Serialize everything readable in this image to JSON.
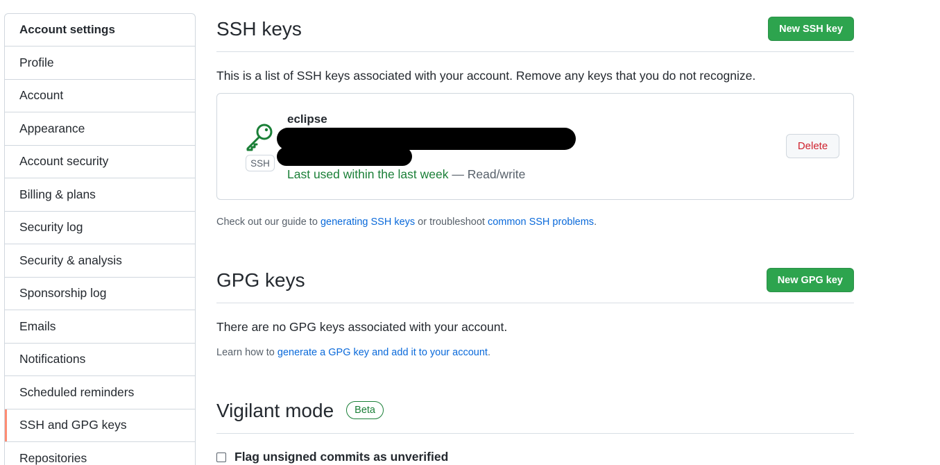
{
  "sidebar": {
    "header": "Account settings",
    "items": [
      {
        "label": "Profile"
      },
      {
        "label": "Account"
      },
      {
        "label": "Appearance"
      },
      {
        "label": "Account security"
      },
      {
        "label": "Billing & plans"
      },
      {
        "label": "Security log"
      },
      {
        "label": "Security & analysis"
      },
      {
        "label": "Sponsorship log"
      },
      {
        "label": "Emails"
      },
      {
        "label": "Notifications"
      },
      {
        "label": "Scheduled reminders"
      },
      {
        "label": "SSH and GPG keys",
        "selected": true
      },
      {
        "label": "Repositories"
      }
    ]
  },
  "ssh": {
    "title": "SSH keys",
    "new_button": "New SSH key",
    "description": "This is a list of SSH keys associated with your account. Remove any keys that you do not recognize.",
    "key": {
      "name": "eclipse",
      "type_tag": "SSH",
      "last_used": "Last used within the last week",
      "separator": " — ",
      "access": "Read/write",
      "delete_label": "Delete"
    },
    "guide_prefix": "Check out our guide to ",
    "guide_link": "generating SSH keys",
    "guide_middle": " or troubleshoot ",
    "problems_link": "common SSH problems",
    "guide_suffix": "."
  },
  "gpg": {
    "title": "GPG keys",
    "new_button": "New GPG key",
    "empty_text": "There are no GPG keys associated with your account.",
    "learn_prefix": "Learn how to ",
    "learn_link": "generate a GPG key and add it to your account",
    "learn_suffix": "."
  },
  "vigilant": {
    "title": "Vigilant mode",
    "badge": "Beta",
    "checkbox_label": "Flag unsigned commits as unverified",
    "checked": false
  },
  "colors": {
    "accent_green": "#2da44e",
    "success_text": "#1a7f37",
    "danger": "#cf222e",
    "link": "#0969da",
    "selected_indicator": "#fd8c73"
  },
  "icons": {
    "key": "key-icon"
  }
}
